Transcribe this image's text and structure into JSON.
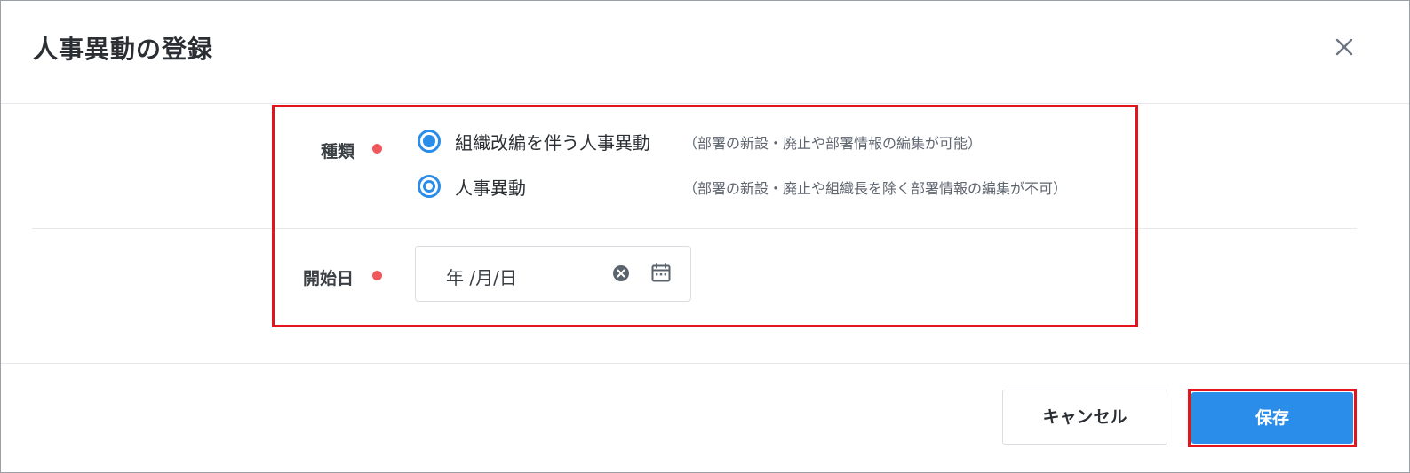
{
  "dialog": {
    "title": "人事異動の登録",
    "close_icon": "close-icon"
  },
  "form": {
    "type_field": {
      "label": "種類",
      "required": true,
      "options": [
        {
          "label": "組織改編を伴う人事異動",
          "note": "（部署の新設・廃止や部署情報の編集が可能）",
          "selected": true
        },
        {
          "label": "人事異動",
          "note": "（部署の新設・廃止や組織長を除く部署情報の編集が不可）",
          "selected": false
        }
      ]
    },
    "start_date_field": {
      "label": "開始日",
      "required": true,
      "value": "年 /月/日",
      "clear_icon": "clear-circle-icon",
      "calendar_icon": "calendar-icon"
    }
  },
  "footer": {
    "cancel_label": "キャンセル",
    "save_label": "保存"
  },
  "colors": {
    "accent": "#2a8de9",
    "required": "#f0585c",
    "highlight": "#e3141b"
  }
}
